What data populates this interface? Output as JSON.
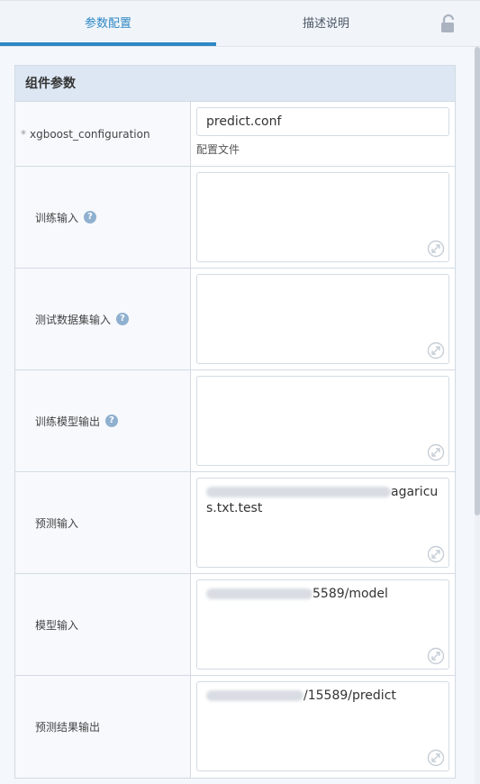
{
  "tabs": [
    {
      "label": "参数配置",
      "active": true
    },
    {
      "label": "描述说明",
      "active": false
    }
  ],
  "panel": {
    "title": "组件参数",
    "rows": [
      {
        "label": "xgboost_configuration",
        "required": true,
        "input_value": "predict.conf",
        "hint": "配置文件"
      },
      {
        "label": "训练输入",
        "help": true,
        "value": ""
      },
      {
        "label": "测试数据集输入",
        "help": true,
        "value": ""
      },
      {
        "label": "训练模型输出",
        "help": true,
        "value": ""
      },
      {
        "label": "预测输入",
        "help": false,
        "value_visible": "agaricus.txt.test"
      },
      {
        "label": "模型输入",
        "help": false,
        "value_visible": "5589/model"
      },
      {
        "label": "预测结果输出",
        "help": false,
        "value_visible": "/15589/predict"
      }
    ]
  },
  "icons": {
    "lock": "unlock-icon",
    "help": "question-icon",
    "expand": "expand-icon"
  },
  "colors": {
    "accent": "#2e88c4",
    "header_bg": "#dde7f3",
    "help": "#8fb0cf"
  }
}
